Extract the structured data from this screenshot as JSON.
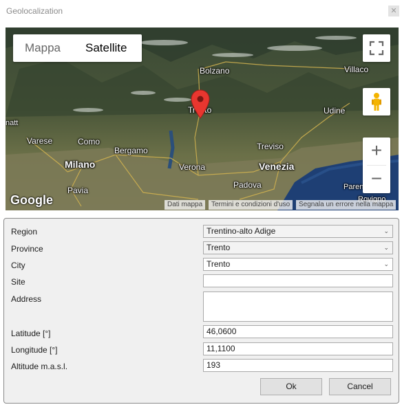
{
  "window": {
    "title": "Geolocalization",
    "close_icon": "close-icon"
  },
  "map": {
    "maptype": {
      "map_label": "Mappa",
      "satellite_label": "Satellite",
      "selected": "Satellite"
    },
    "labels": {
      "bolzano": "Bolzano",
      "trento": "Trento",
      "villaco": "Villaco",
      "udine": "Udine",
      "varese": "Varese",
      "como": "Como",
      "bergamo": "Bergamo",
      "milano": "Milano",
      "verona": "Verona",
      "venezia": "Venezia",
      "treviso": "Treviso",
      "padova": "Padova",
      "pavia": "Pavia",
      "parenzo": "Parenz",
      "rovigno": "Rovigno",
      "edge": "natt"
    },
    "logo": "Google",
    "attribution": {
      "data": "Dati mappa",
      "terms": "Termini e condizioni d'uso",
      "report": "Segnala un errore nella mappa"
    },
    "controls": {
      "zoom_in": "+",
      "zoom_out": "−"
    }
  },
  "form": {
    "region": {
      "label": "Region",
      "value": "Trentino-alto Adige"
    },
    "province": {
      "label": "Province",
      "value": "Trento"
    },
    "city": {
      "label": "City",
      "value": "Trento"
    },
    "site": {
      "label": "Site",
      "value": ""
    },
    "address": {
      "label": "Address",
      "value": ""
    },
    "latitude": {
      "label": "Latitude [°]",
      "value": "46,0600"
    },
    "longitude": {
      "label": "Longitude [°]",
      "value": "11,1100"
    },
    "altitude": {
      "label": "Altitude m.a.s.l.",
      "value": "193"
    },
    "ok_label": "Ok",
    "cancel_label": "Cancel"
  }
}
